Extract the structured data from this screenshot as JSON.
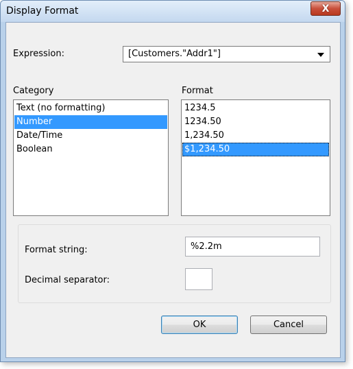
{
  "window": {
    "title": "Display Format",
    "close_glyph": "X"
  },
  "expression": {
    "label": "Expression:",
    "value": "[Customers.\"Addr1\"]"
  },
  "category": {
    "label": "Category",
    "items": [
      "Text (no formatting)",
      "Number",
      "Date/Time",
      "Boolean"
    ],
    "selected": "Number"
  },
  "format": {
    "label": "Format",
    "items": [
      "1234.5",
      "1234.50",
      "1,234.50",
      "$1,234.50"
    ],
    "selected": "$1,234.50"
  },
  "format_string": {
    "label": "Format string:",
    "value": "%2.2m"
  },
  "decimal_separator": {
    "label": "Decimal separator:",
    "value": ""
  },
  "buttons": {
    "ok": "OK",
    "cancel": "Cancel"
  },
  "colors": {
    "selection": "#3399ff",
    "title_bar": "#c4d8ef",
    "close_button": "#c9503b"
  }
}
